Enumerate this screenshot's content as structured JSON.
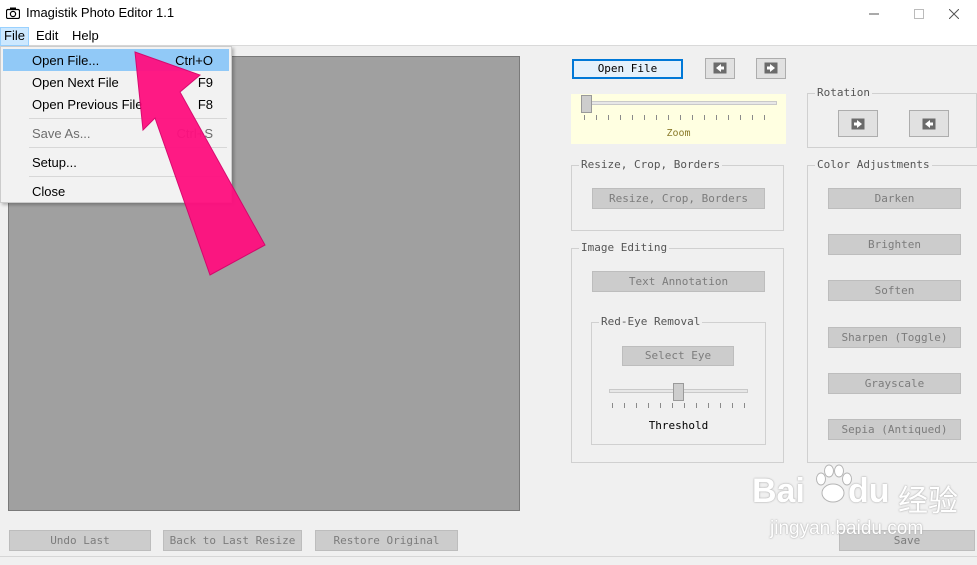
{
  "window": {
    "title": "Imagistik Photo Editor 1.1",
    "app_icon": "camera-icon",
    "controls": [
      "minimize-icon",
      "maximize-icon",
      "close-icon"
    ]
  },
  "menubar": {
    "items": [
      {
        "label": "File",
        "active": true
      },
      {
        "label": "Edit"
      },
      {
        "label": "Help"
      }
    ]
  },
  "file_menu": {
    "items": [
      {
        "label": "Open File...",
        "shortcut": "Ctrl+O",
        "highlighted": true
      },
      {
        "label": "Open Next File",
        "shortcut": "F9"
      },
      {
        "label": "Open Previous File",
        "shortcut": "F8"
      },
      {
        "label": "Save As...",
        "shortcut": "Ctrl+S",
        "disabled": true
      },
      {
        "label": "Setup..."
      },
      {
        "label": "Close"
      }
    ]
  },
  "toolbar": {
    "open_file": "Open File",
    "prev_icon": "arrow-left-icon",
    "next_icon": "arrow-right-icon"
  },
  "zoom": {
    "label": "Zoom",
    "value_fraction": 0.0
  },
  "rotation": {
    "title": "Rotation",
    "rotate_right_icon": "rotate-right-icon",
    "rotate_left_icon": "rotate-left-icon"
  },
  "resize_group": {
    "title": "Resize, Crop, Borders",
    "button": "Resize, Crop, Borders"
  },
  "image_editing": {
    "title": "Image Editing",
    "text_annotation": "Text Annotation",
    "red_eye": {
      "title": "Red-Eye Removal",
      "select_eye": "Select Eye",
      "threshold_label": "Threshold",
      "threshold_fraction": 0.5
    }
  },
  "color_adjustments": {
    "title": "Color Adjustments",
    "buttons": [
      "Darken",
      "Brighten",
      "Soften",
      "Sharpen (Toggle)",
      "Grayscale",
      "Sepia (Antiqued)"
    ]
  },
  "bottom": {
    "undo": "Undo Last",
    "back_resize": "Back to Last Resize",
    "restore": "Restore Original",
    "save": "Save"
  },
  "watermark": {
    "brand": "Bai",
    "brand2": "du",
    "cn": "经验",
    "url": "jingyan.baidu.com",
    "icon": "paw-icon"
  },
  "annotation": {
    "arrow_color": "#ff0f7f",
    "icon": "pointer-arrow-icon"
  },
  "colors": {
    "accent": "#0078d7",
    "menu_highlight": "#91c9f7",
    "viewer_bg": "#a0a0a0",
    "zoom_bg": "#ffffe1"
  }
}
